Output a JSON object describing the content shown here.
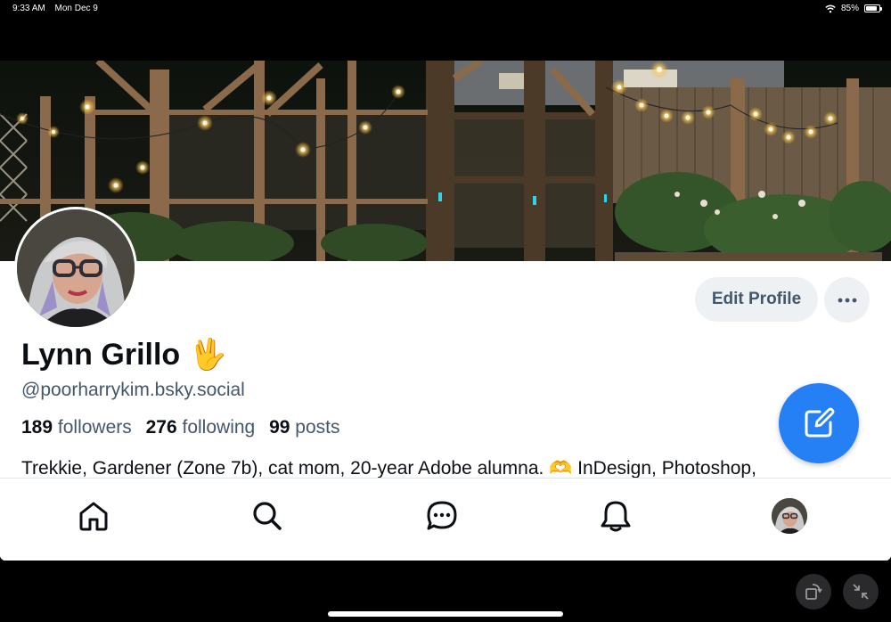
{
  "status_bar": {
    "time": "9:33 AM",
    "date": "Mon Dec 9",
    "wifi_icon": "wifi-icon",
    "battery_percent": "85%",
    "battery_level": 0.85
  },
  "profile": {
    "display_name": "Lynn Grillo",
    "name_emoji": "🖖",
    "handle": "@poorharrykim.bsky.social",
    "stats": {
      "followers_count": "189",
      "followers_label": "followers",
      "following_count": "276",
      "following_label": "following",
      "posts_count": "99",
      "posts_label": "posts"
    },
    "bio": "Trekkie, Gardener (Zone 7b), cat mom, 20-year Adobe alumna. 🫶 InDesign, Photoshop,"
  },
  "actions": {
    "edit_profile_label": "Edit Profile",
    "more_icon": "ellipsis-icon",
    "compose_icon": "compose-icon"
  },
  "bottom_nav": {
    "items": [
      {
        "name": "home",
        "icon": "home-icon"
      },
      {
        "name": "search",
        "icon": "search-icon"
      },
      {
        "name": "chat",
        "icon": "chat-icon"
      },
      {
        "name": "notifications",
        "icon": "bell-icon"
      },
      {
        "name": "profile",
        "icon": "avatar"
      }
    ]
  },
  "colors": {
    "accent": "#2680f5",
    "text_primary": "#0b0f14",
    "text_secondary": "#42576c",
    "button_bg": "#eef1f4"
  }
}
